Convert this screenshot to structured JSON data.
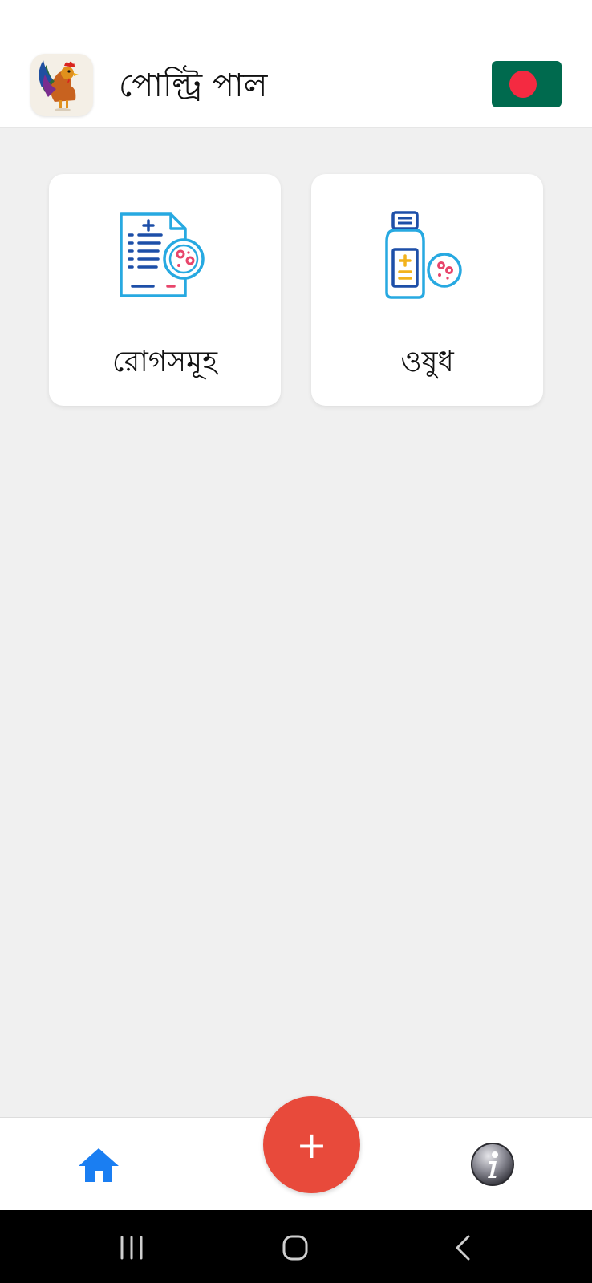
{
  "header": {
    "title": "পোল্ট্রি পাল",
    "logo_icon": "rooster-logo-icon",
    "flag_icon": "bangladesh-flag-icon",
    "flag_colors": {
      "field": "#006a4e",
      "disc": "#f42a41"
    }
  },
  "cards": [
    {
      "label": "রোগসমূহ",
      "icon": "disease-report-icon"
    },
    {
      "label": "ওষুধ",
      "icon": "medicine-bottle-icon"
    }
  ],
  "bottom_nav": {
    "home_icon": "home-icon",
    "add_label": "+",
    "info_icon": "info-icon",
    "accent_color": "#1a7ef2",
    "fab_color": "#e84a3b"
  },
  "system_nav": {
    "recents_icon": "recents-icon",
    "home_icon": "circle-home-icon",
    "back_icon": "back-chevron-icon"
  }
}
